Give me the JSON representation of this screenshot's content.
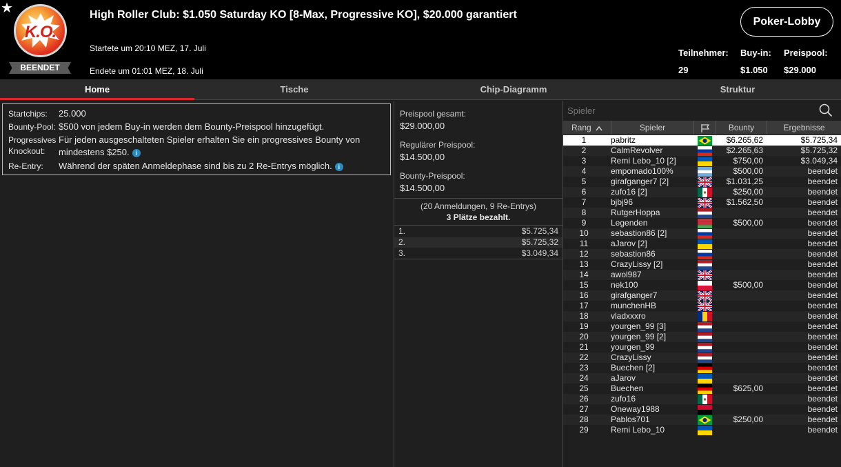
{
  "header": {
    "title": "High Roller Club: $1.050 Saturday KO [8-Max, Progressive KO], $20.000 garantiert",
    "logo_text": "K.O.",
    "status_badge": "BEENDET",
    "started": "Startete um 20:10 MEZ, 17. Juli",
    "ended": "Endete um 01:01 MEZ, 18. Juli",
    "lobby_button": "Poker-Lobby",
    "stats": [
      {
        "label": "Teilnehmer:",
        "value": "29"
      },
      {
        "label": "Buy-in:",
        "value": "$1.050"
      },
      {
        "label": "Preispool:",
        "value": "$29.000"
      }
    ]
  },
  "tabs": [
    {
      "label": "Home",
      "active": true
    },
    {
      "label": "Tische",
      "active": false
    },
    {
      "label": "Chip-Diagramm",
      "active": false
    },
    {
      "label": "Struktur",
      "active": false
    }
  ],
  "info": {
    "startchips_label": "Startchips:",
    "startchips_value": "25.000",
    "bounty_label": "Bounty-Pool:",
    "bounty_value": "$500 von jedem Buy-in werden dem Bounty-Preispool hinzugefügt.",
    "pko_label": "Progressives Knockout:",
    "pko_value": "Für jeden ausgeschalteten Spieler erhalten Sie ein progressives Bounty von mindestens $250.",
    "reentry_label": "Re-Entry:",
    "reentry_value": "Während der späten Anmeldephase sind bis zu 2 Re-Entrys möglich.",
    "info_icon_glyph": "i"
  },
  "prize": {
    "total_label": "Preispool gesamt:",
    "total_value": "$29.000,00",
    "regular_label": "Regulärer Preispool:",
    "regular_value": "$14.500,00",
    "bounty_label": "Bounty-Preispool:",
    "bounty_value": "$14.500,00",
    "registrations": "(20 Anmeldungen, 9 Re-Entrys)",
    "paid": "3 Plätze bezahlt.",
    "payouts": [
      {
        "rank": "1.",
        "value": "$5.725,34"
      },
      {
        "rank": "2.",
        "value": "$5.725,32"
      },
      {
        "rank": "3.",
        "value": "$3.049,34"
      }
    ]
  },
  "players": {
    "search_placeholder": "Spieler",
    "columns": {
      "rank": "Rang",
      "player": "Spieler",
      "bounty": "Bounty",
      "results": "Ergebnisse"
    },
    "rows": [
      {
        "rank": "1",
        "name": "pabritz",
        "flag": "br",
        "bounty": "$6.265,62",
        "result": "$5.725,34"
      },
      {
        "rank": "2",
        "name": "CalmRevolver",
        "flag": "ru",
        "bounty": "$2.265,63",
        "result": "$5.725,32"
      },
      {
        "rank": "3",
        "name": "Remi Lebo_10 [2]",
        "flag": "ua",
        "bounty": "$750,00",
        "result": "$3.049,34"
      },
      {
        "rank": "4",
        "name": "empomado100%",
        "flag": "ar",
        "bounty": "$500,00",
        "result": "beendet"
      },
      {
        "rank": "5",
        "name": "girafganger7 [2]",
        "flag": "gb",
        "bounty": "$1.031,25",
        "result": "beendet"
      },
      {
        "rank": "6",
        "name": "zufo16 [2]",
        "flag": "mx",
        "bounty": "$250,00",
        "result": "beendet"
      },
      {
        "rank": "7",
        "name": "bjbj96",
        "flag": "gb",
        "bounty": "$1.562,50",
        "result": "beendet"
      },
      {
        "rank": "8",
        "name": "RutgerHoppa",
        "flag": "nl",
        "bounty": "",
        "result": "beendet"
      },
      {
        "rank": "9",
        "name": "Legenden",
        "flag": "by",
        "bounty": "$500,00",
        "result": "beendet"
      },
      {
        "rank": "10",
        "name": "sebastion86 [2]",
        "flag": "ru",
        "bounty": "",
        "result": "beendet"
      },
      {
        "rank": "11",
        "name": "aJarov [2]",
        "flag": "ua",
        "bounty": "",
        "result": "beendet"
      },
      {
        "rank": "12",
        "name": "sebastion86",
        "flag": "ru",
        "bounty": "",
        "result": "beendet"
      },
      {
        "rank": "13",
        "name": "CrazyLissy [2]",
        "flag": "nl",
        "bounty": "",
        "result": "beendet"
      },
      {
        "rank": "14",
        "name": "awol987",
        "flag": "gb",
        "bounty": "",
        "result": "beendet"
      },
      {
        "rank": "15",
        "name": "nek100",
        "flag": "pl",
        "bounty": "$500,00",
        "result": "beendet"
      },
      {
        "rank": "16",
        "name": "girafganger7",
        "flag": "gb",
        "bounty": "",
        "result": "beendet"
      },
      {
        "rank": "17",
        "name": "munchenHB",
        "flag": "gb",
        "bounty": "",
        "result": "beendet"
      },
      {
        "rank": "18",
        "name": "vladxxxro",
        "flag": "ro",
        "bounty": "",
        "result": "beendet"
      },
      {
        "rank": "19",
        "name": "yourgen_99 [3]",
        "flag": "nl",
        "bounty": "",
        "result": "beendet"
      },
      {
        "rank": "20",
        "name": "yourgen_99 [2]",
        "flag": "nl",
        "bounty": "",
        "result": "beendet"
      },
      {
        "rank": "21",
        "name": "yourgen_99",
        "flag": "nl",
        "bounty": "",
        "result": "beendet"
      },
      {
        "rank": "22",
        "name": "CrazyLissy",
        "flag": "nl",
        "bounty": "",
        "result": "beendet"
      },
      {
        "rank": "23",
        "name": "Buechen [2]",
        "flag": "de",
        "bounty": "",
        "result": "beendet"
      },
      {
        "rank": "24",
        "name": "aJarov",
        "flag": "ua",
        "bounty": "",
        "result": "beendet"
      },
      {
        "rank": "25",
        "name": "Buechen",
        "flag": "de",
        "bounty": "$625,00",
        "result": "beendet"
      },
      {
        "rank": "26",
        "name": "zufo16",
        "flag": "mx",
        "bounty": "",
        "result": "beendet"
      },
      {
        "rank": "27",
        "name": "Oneway1988",
        "flag": "ao",
        "bounty": "",
        "result": "beendet"
      },
      {
        "rank": "28",
        "name": "Pablos701",
        "flag": "br",
        "bounty": "$250,00",
        "result": "beendet"
      },
      {
        "rank": "29",
        "name": "Remi Lebo_10",
        "flag": "ua",
        "bounty": "",
        "result": "beendet"
      }
    ]
  },
  "colors": {
    "accent": "#e0242c",
    "info_icon": "#2a8bc0"
  }
}
